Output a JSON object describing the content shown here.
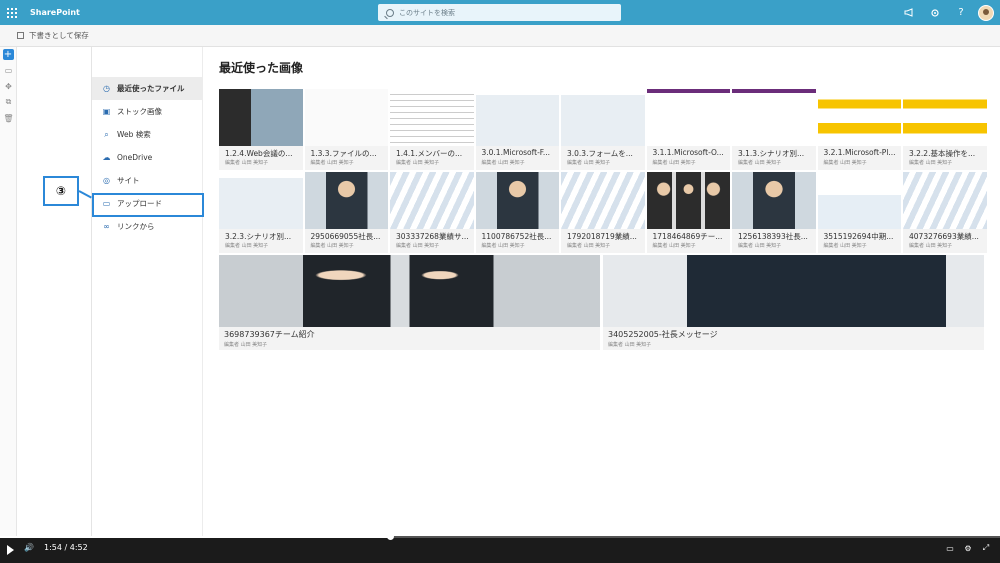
{
  "suite": {
    "brand": "SharePoint",
    "search_placeholder": "このサイトを検索",
    "icons": [
      "megaphone-icon",
      "gear-icon",
      "help-icon"
    ],
    "help_label": "?"
  },
  "cmdbar": {
    "save_label": "下書きとして保存"
  },
  "rail": {
    "add_label": "+"
  },
  "nav": {
    "items": [
      {
        "label": "最近使ったファイル",
        "icon": "clock-icon"
      },
      {
        "label": "ストック画像",
        "icon": "image-icon"
      },
      {
        "label": "Web 検索",
        "icon": "search-icon"
      },
      {
        "label": "OneDrive",
        "icon": "cloud-icon"
      },
      {
        "label": "サイト",
        "icon": "globe-icon"
      },
      {
        "label": "アップロード",
        "icon": "upload-icon"
      },
      {
        "label": "リンクから",
        "icon": "link-icon"
      }
    ]
  },
  "callout": {
    "number": "③"
  },
  "main": {
    "heading": "最近使った画像",
    "subtitle": "編集者 山田 美知子",
    "row1": [
      {
        "title": "1.2.4.Web会議の..."
      },
      {
        "title": "1.3.3.ファイルの..."
      },
      {
        "title": "1.4.1.メンバーの..."
      },
      {
        "title": "3.0.1.Microsoft-F..."
      },
      {
        "title": "3.0.3.フォームを..."
      },
      {
        "title": "3.1.1.Microsoft-O..."
      },
      {
        "title": "3.1.3.シナリオ別..."
      },
      {
        "title": "3.2.1.Microsoft-Pl..."
      },
      {
        "title": "3.2.2.基本操作を..."
      }
    ],
    "row2": [
      {
        "title": "3.2.3.シナリオ別..."
      },
      {
        "title": "2950669055社長..."
      },
      {
        "title": "303337268業績サ..."
      },
      {
        "title": "1100786752社長..."
      },
      {
        "title": "1792018719業績..."
      },
      {
        "title": "1718464869チー..."
      },
      {
        "title": "1256138393社長..."
      },
      {
        "title": "3515192694中期..."
      },
      {
        "title": "4073276693業績..."
      }
    ],
    "row3": [
      {
        "title": "3698739367チーム紹介"
      },
      {
        "title": "3405252005-社長メッセージ"
      }
    ]
  },
  "video": {
    "current_time": "1:54",
    "separator": "/",
    "duration": "4:52",
    "progress": 0.39
  }
}
